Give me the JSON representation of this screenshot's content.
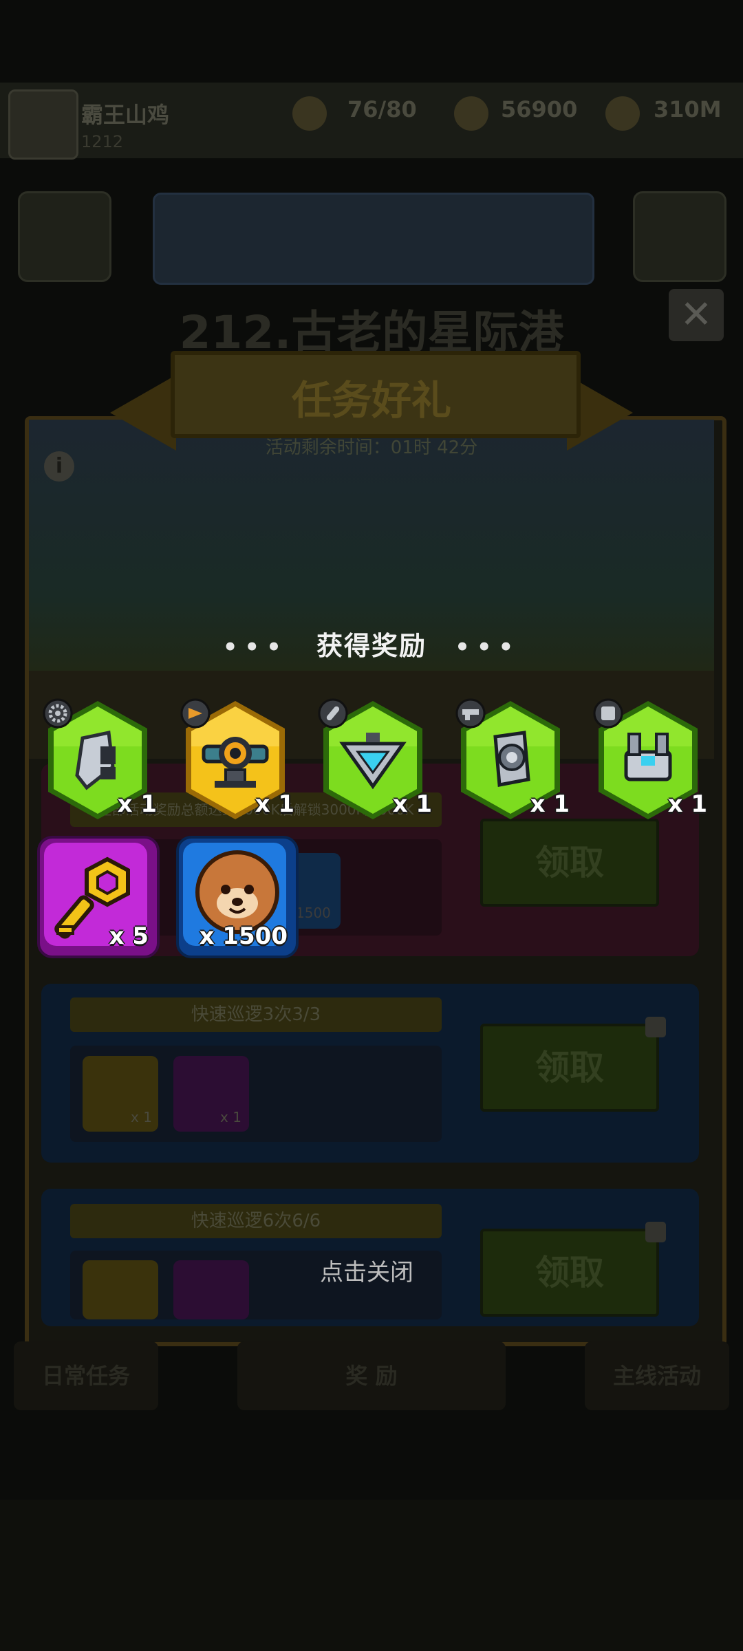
{
  "player": {
    "name": "霸王山鸡",
    "level": "1212"
  },
  "resources": [
    {
      "icon": "energy-icon",
      "value": "76/80"
    },
    {
      "icon": "coin-icon",
      "value": "56900"
    },
    {
      "icon": "gem-icon",
      "value": "310M"
    }
  ],
  "chapter": {
    "title": "212.古老的星际港"
  },
  "event": {
    "title": "任务好礼",
    "time_remaining": "活动剩余时间：01时 42分",
    "tabs_text": "任务好礼 · 快速 · 领取"
  },
  "tasks": [
    {
      "title": "全部活动奖励总额达到3000K后解锁3000K/3000K",
      "claim": "领取",
      "item_count": "1500"
    },
    {
      "title": "快速巡逻3次3/3",
      "claim": "领取",
      "items": [
        "x 1",
        "x 1"
      ]
    },
    {
      "title": "快速巡逻6次6/6",
      "claim": "领取"
    }
  ],
  "bottom_nav": {
    "left": "日常任务",
    "center": "奖 励",
    "right": "主线活动"
  },
  "overlay": {
    "title": "获得奖励",
    "close_hint": "点击关闭",
    "rewards": [
      {
        "name": "shield-part",
        "rarity": "green",
        "count": "x 1"
      },
      {
        "name": "turret-scope",
        "rarity": "gold",
        "count": "x 1"
      },
      {
        "name": "triangle-core",
        "rarity": "green",
        "count": "x 1"
      },
      {
        "name": "cylinder-barrel",
        "rarity": "green",
        "count": "x 1"
      },
      {
        "name": "mech-block",
        "rarity": "green",
        "count": "x 1"
      }
    ],
    "items": [
      {
        "name": "gold-key",
        "count": "x 5",
        "color": "#c22ad8"
      },
      {
        "name": "dog-cookie",
        "count": "x 1500",
        "color": "#1f7ae0"
      }
    ]
  },
  "colors": {
    "green": "#7ddc1f",
    "gold": "#f4c21a",
    "purple": "#c22ad8",
    "blue": "#1f7ae0"
  }
}
